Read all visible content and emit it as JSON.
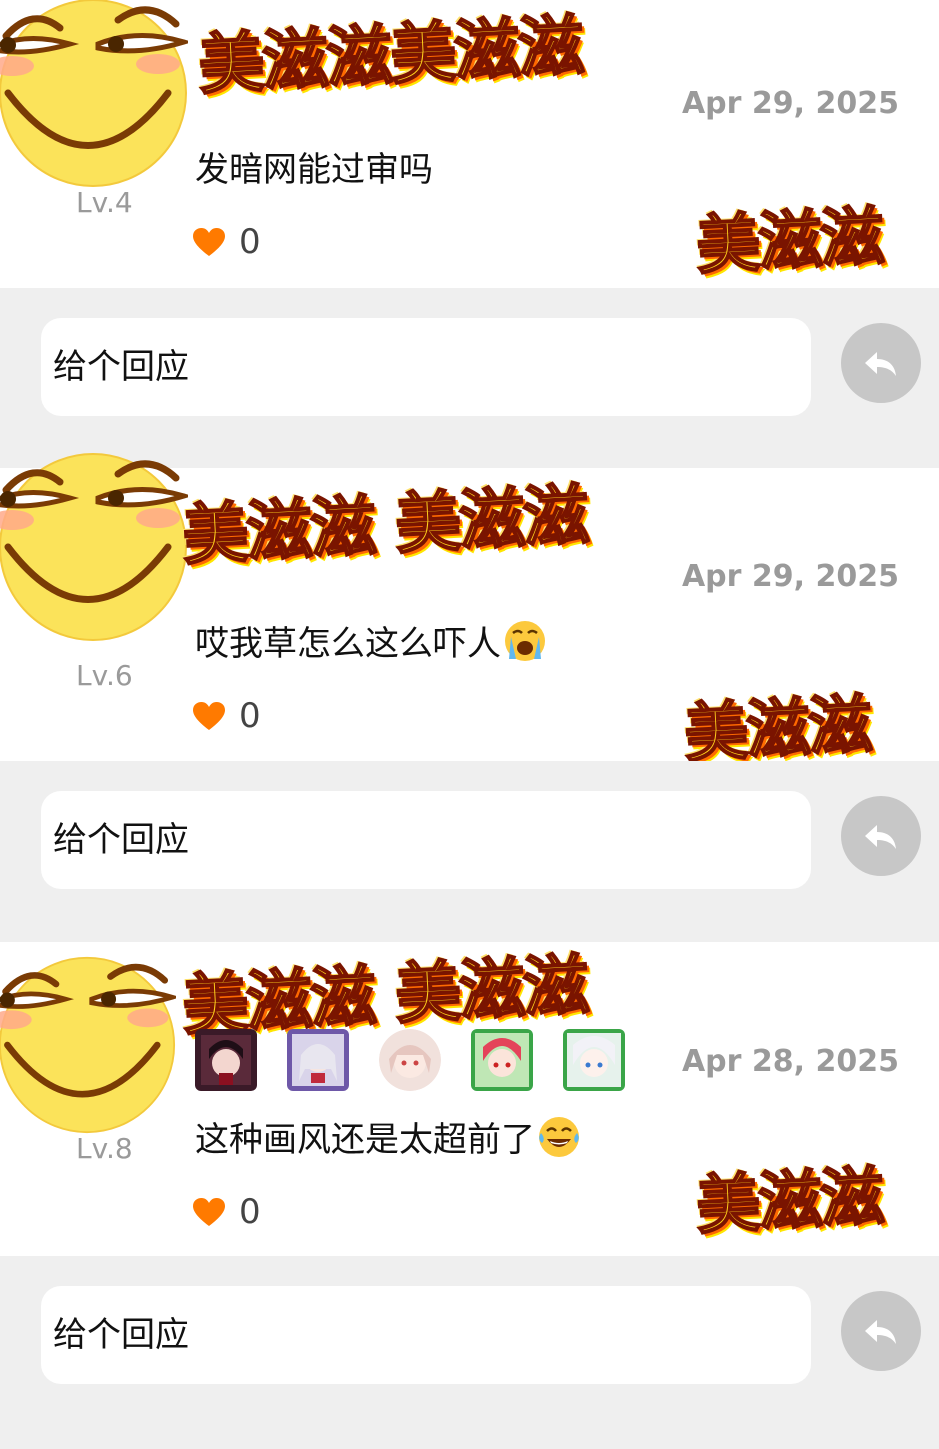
{
  "comments": [
    {
      "level": "Lv.4",
      "date": "Apr 29, 2025",
      "text": "发暗网能过审吗",
      "emoji": "",
      "likes": "0",
      "sticker_header": "美滋滋美滋滋",
      "sticker_corner": "美滋滋"
    },
    {
      "level": "Lv.6",
      "date": "Apr 29, 2025",
      "text": "哎我草怎么这么吓人",
      "emoji": "crying-face",
      "likes": "0",
      "sticker_header": "美滋滋 美滋滋",
      "sticker_corner": "美滋滋"
    },
    {
      "level": "Lv.8",
      "date": "Apr 28, 2025",
      "text": "这种画风还是太超前了",
      "emoji": "laughing-tears-face",
      "likes": "0",
      "sticker_header": "美滋滋 美滋滋",
      "sticker_corner": "美滋滋",
      "badges": [
        "anime-avatar-dark-hair",
        "anime-avatar-silver-hair",
        "anime-avatar-pink-round",
        "anime-avatar-red-hair",
        "anime-avatar-white-hair"
      ]
    }
  ],
  "reply": {
    "placeholder": "给个回应",
    "send_icon": "reply-arrow-icon"
  },
  "colors": {
    "heart": "#ff7a00",
    "reply_button": "#c7c7c7",
    "background": "#efefef",
    "sticker_fill": "#ffd21c"
  }
}
